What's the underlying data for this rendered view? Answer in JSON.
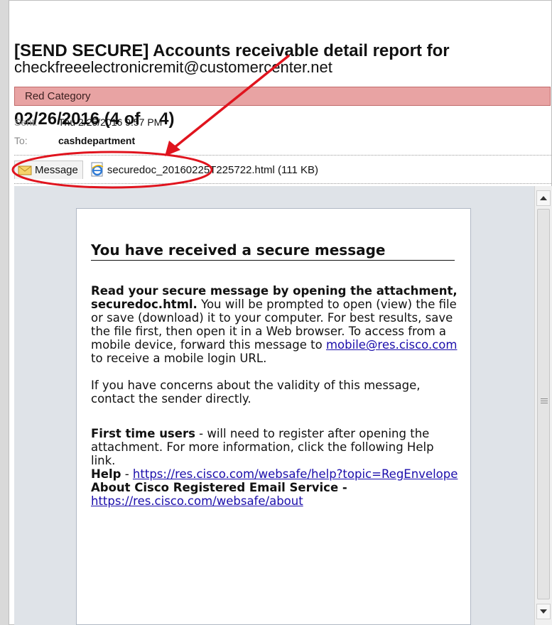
{
  "email": {
    "subject_line1": "[SEND SECURE] Accounts receivable detail report for",
    "subject_line2": "02/26/2016 (4 of    4)",
    "sender": "checkfreeelectronicremit@customercenter.net",
    "category": "Red Category",
    "sent_label": "Sent:",
    "sent_value": "Thu 2/25/2016 9:57 PM",
    "to_label": "To:",
    "to_value": "cashdepartment"
  },
  "attachments": {
    "message_tab": "Message",
    "file": "securedoc_20160225T225722.html (111 KB)"
  },
  "body": {
    "title": "You have received a secure message",
    "p1_bold": "Read your secure message by opening the attachment, securedoc.html.",
    "p1_text": " You will be prompted to open (view) the file or save (download) it to your computer. For best results, save the file first, then open it in a Web browser. To access from a mobile device, forward this message to ",
    "p1_link": "mobile@res.cisco.com",
    "p1_tail": " to receive a mobile login URL.",
    "p2": "If you have concerns about the validity of this message, contact the sender directly.",
    "p3_bold": "First time users",
    "p3_text": " - will need to register after opening the attachment. For more information, click the following Help link.",
    "help_label": "Help",
    "help_sep": " - ",
    "help_link": "https://res.cisco.com/websafe/help?topic=RegEnvelope",
    "about_label": "About Cisco Registered Email Service",
    "about_sep": " -",
    "about_link": "https://res.cisco.com/websafe/about"
  },
  "colors": {
    "category_bg": "#e8a3a3",
    "annotation_red": "#e0141e",
    "link": "#1a0dab"
  },
  "icons": {
    "message_tab": "envelope-icon",
    "attachment": "ie-html-file-icon",
    "scroll_up": "arrow-up-icon",
    "scroll_down": "arrow-down-icon"
  }
}
